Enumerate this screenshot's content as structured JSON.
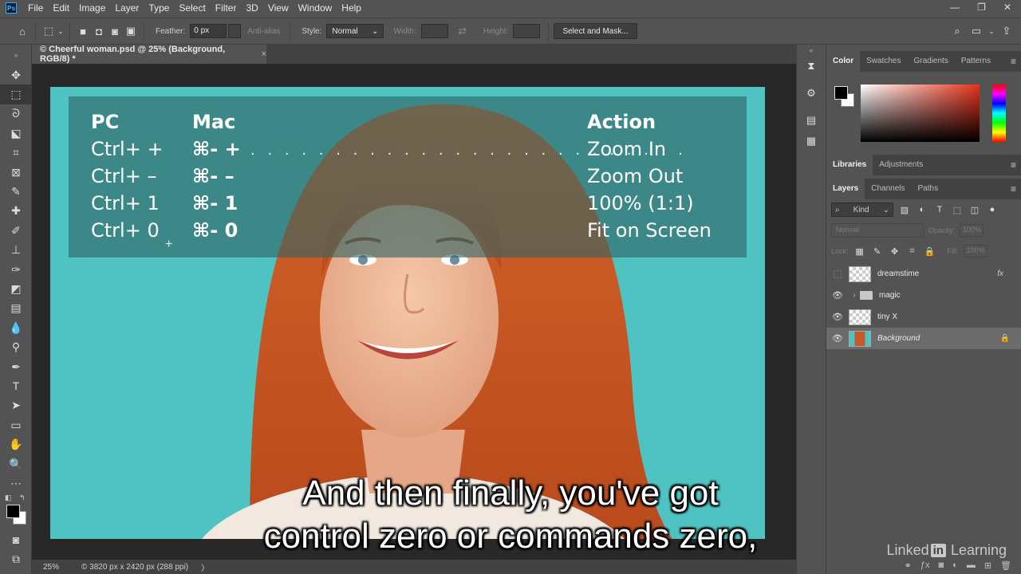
{
  "menu": {
    "app_icon": "Ps",
    "items": [
      "File",
      "Edit",
      "Image",
      "Layer",
      "Type",
      "Select",
      "Filter",
      "3D",
      "View",
      "Window",
      "Help"
    ],
    "minimize": "—",
    "maximize": "❐",
    "close": "✕"
  },
  "options": {
    "feather_label": "Feather:",
    "feather_value": "0 px",
    "antialias_label": "Anti-alias",
    "style_label": "Style:",
    "style_value": "Normal",
    "width_label": "Width:",
    "height_label": "Height:",
    "select_mask_label": "Select and Mask..."
  },
  "document": {
    "tab_title": "© Cheerful woman.psd @ 25% (Background, RGB/8) *",
    "tab_close": "×",
    "zoom": "25%",
    "info": "© 3820 px x 2420 px (288 ppi)",
    "info_arrow": "〉"
  },
  "shortcuts": {
    "headers": {
      "pc": "PC",
      "mac": "Mac",
      "action": "Action"
    },
    "dots": ". . . . . . . . . . . . . . . . . . . . . . . . . .",
    "rows": [
      {
        "pc": "Ctrl+ +",
        "mac": "⌘- +",
        "action": "Zoom In"
      },
      {
        "pc": "Ctrl+ –",
        "mac": "⌘- –",
        "action": "Zoom Out"
      },
      {
        "pc": "Ctrl+ 1",
        "mac": "⌘- 1",
        "action": "100% (1:1)"
      },
      {
        "pc": "Ctrl+ 0",
        "mac": "⌘- 0",
        "action": "Fit on Screen"
      }
    ]
  },
  "caption": {
    "line1": "And then finally, you've got",
    "line2": "control zero or commands zero,"
  },
  "watermark": {
    "prefix": "Linked",
    "in": "in",
    "suffix": "Learning"
  },
  "color_panel": {
    "tabs": [
      "Color",
      "Swatches",
      "Gradients",
      "Patterns"
    ],
    "foreground": "#000000",
    "background": "#ffffff"
  },
  "lib_panel": {
    "tabs": [
      "Libraries",
      "Adjustments"
    ]
  },
  "layers_panel": {
    "tabs": [
      "Layers",
      "Channels",
      "Paths"
    ],
    "kind_label": "Kind",
    "blend_mode": "Normal",
    "opacity_label": "Opacity:",
    "opacity_value": "100%",
    "lock_label": "Lock:",
    "fill_label": "Fill:",
    "fill_value": "100%",
    "layers": [
      {
        "name": "dreamstime",
        "visible": false,
        "fx": "fx"
      },
      {
        "name": "magic",
        "visible": true,
        "type": "group"
      },
      {
        "name": "tiny X",
        "visible": true
      },
      {
        "name": "Background",
        "visible": true,
        "locked": true,
        "selected": true
      }
    ]
  }
}
